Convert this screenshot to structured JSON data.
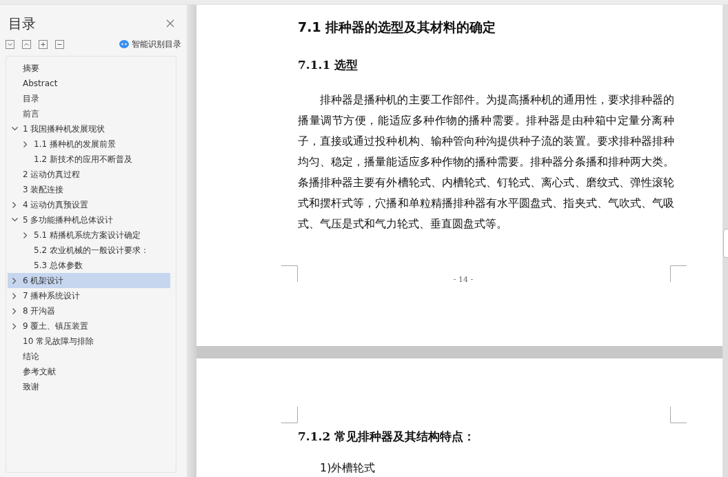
{
  "sidebar": {
    "title": "目录",
    "smart_toc_label": "智能识别目录",
    "items": [
      {
        "label": "摘要",
        "selected": false
      },
      {
        "label": "Abstract",
        "selected": false
      },
      {
        "label": "目录",
        "selected": false
      },
      {
        "label": "前言",
        "selected": false
      },
      {
        "label": "1 我国播种机发展现状",
        "selected": false,
        "expanded": true,
        "children": [
          {
            "label": "1.1 播种机的发展前景",
            "selected": false,
            "expanded": false
          },
          {
            "label": "1.2 新技术的应用不断普及",
            "selected": false
          }
        ]
      },
      {
        "label": "2 运动仿真过程",
        "selected": false
      },
      {
        "label": "3 装配连接",
        "selected": false
      },
      {
        "label": "4  运动仿真预设置",
        "selected": false,
        "expanded": false
      },
      {
        "label": "5 多功能播种机总体设计",
        "selected": false,
        "expanded": true,
        "children": [
          {
            "label": "5.1 精播机系统方案设计确定",
            "selected": false,
            "expanded": false
          },
          {
            "label": "5.2 农业机械的一般设计要求：",
            "selected": false
          },
          {
            "label": "5.3 总体参数",
            "selected": false
          }
        ]
      },
      {
        "label": "6 机架设计",
        "selected": true,
        "expanded": false
      },
      {
        "label": "7 播种系统设计",
        "selected": false,
        "expanded": false
      },
      {
        "label": "8 开沟器",
        "selected": false,
        "expanded": false
      },
      {
        "label": "9 覆土、镇压装置",
        "selected": false,
        "expanded": false
      },
      {
        "label": "10  常见故障与排除",
        "selected": false
      },
      {
        "label": "结论",
        "selected": false
      },
      {
        "label": "参考文献",
        "selected": false
      },
      {
        "label": "致谢",
        "selected": false
      }
    ]
  },
  "document": {
    "pages": [
      {
        "blocks": [
          {
            "kind": "heading",
            "text": "7.1 排种器的选型及其材料的确定"
          },
          {
            "kind": "subheading",
            "text": "7.1.1 选型"
          },
          {
            "kind": "paragraph",
            "text": "排种器是播种机的主要工作部件。为提高播种机的通用性，要求排种器的播量调节方便，能适应多种作物的播种需要。排种器是由种箱中定量分离种子，直接或通过投种机构、输种管向种沟提供种子流的装置。要求排种器排种均匀、稳定，播量能适应多种作物的播种需要。排种器分条播和排种两大类。条播排种器主要有外槽轮式、内槽轮式、钉轮式、离心式、磨纹式、弹性滚轮式和摆杆式等，穴播和单粒精播排种器有水平圆盘式、指夹式、气吹式、气吸式、气压是式和气力轮式、垂直圆盘式等。"
          }
        ],
        "footer": "- 14 -"
      },
      {
        "blocks": [
          {
            "kind": "subheading",
            "text": "7.1.2 常见排种器及其结构特点："
          },
          {
            "kind": "paragraph",
            "text": "1)外槽轮式"
          }
        ]
      }
    ]
  }
}
